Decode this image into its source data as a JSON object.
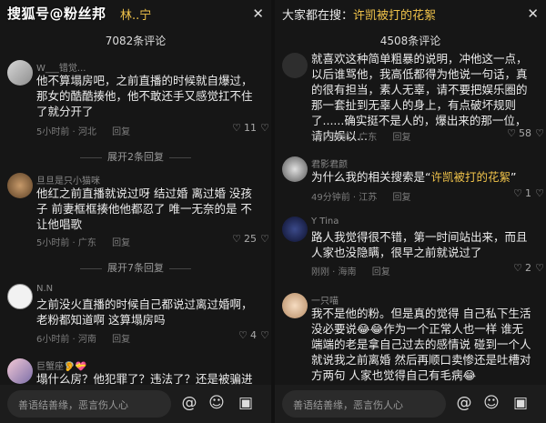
{
  "watermark": "搜狐号@粉丝邦",
  "left": {
    "header_query": "林..宁",
    "close_icon": "✕",
    "comment_count": "7082条评论",
    "comments": [
      {
        "user": "W___错觉...",
        "text": "他不算塌房吧，之前直播的时候就自爆过，那女的酷酷揍他，他不敢还手又感觉扛不住了就分开了",
        "time": "5小时前 · 河北",
        "reply": "回复",
        "likes": "11"
      },
      {
        "expand": "展开2条回复"
      },
      {
        "user": "旦旦是只小猫咪",
        "text": "他红之前直播就说过呀 结过婚 离过婚 没孩子 前妻框框揍他他都忍了 唯一无奈的是 不让他唱歌",
        "time": "5小时前 · 广东",
        "reply": "回复",
        "likes": "25"
      },
      {
        "expand": "展开7条回复"
      },
      {
        "user": "N.N",
        "text": "之前没火直播的时候自己都说过离过婚啊，老粉都知道啊 这算塌房吗",
        "time": "6小时前 · 河南",
        "reply": "回复",
        "likes": "4"
      },
      {
        "user": "巨蟹座🦻💝",
        "text": "塌什么房？他犯罪了？违法了？还是被骗进",
        "time": "",
        "reply": "",
        "likes": ""
      }
    ],
    "input_placeholder": "善语结善缘，恶言伤人心"
  },
  "right": {
    "header_prefix": "大家都在搜：",
    "header_query": "许凯被打的花絮",
    "close_icon": "✕",
    "comment_count": "4508条评论",
    "comments": [
      {
        "user": "",
        "text": "就喜欢这种简单粗暴的说明，冲他这一点，以后谁骂他，我高低都得为他说一句话，真的很有担当，素人无辜，请不要把娱乐圈的那一套扯到无辜人的身上，有点破坏规则了......确实挺不是人的，爆出来的那一位，请内娱以...",
        "time": "12分钟前 · 广东",
        "reply": "回复",
        "likes": "58"
      },
      {
        "user": "君影君颜",
        "text_prefix": "为什么我的相关搜索是“",
        "text_highlight": "许凯被打的花絮",
        "text_suffix": "”",
        "time": "49分钟前 · 江苏",
        "reply": "回复",
        "likes": "1"
      },
      {
        "user": "Y Tina",
        "text": "路人我觉得很不错，第一时间站出来，而且人家也没隐瞒，很早之前就说过了",
        "time": "刚刚 · 海南",
        "reply": "回复",
        "likes": "2"
      },
      {
        "user": "一只喵",
        "text": "我不是他的粉。但是真的觉得 自己私下生活没必要说😂😂作为一个正常人也一样 谁无端端的老是拿自己过去的感情说 碰到一个人就说我之前离婚 然后再顺口卖惨还是吐槽对方两句 人家也觉得自己有毛病😂",
        "time": "",
        "reply": "",
        "likes": ""
      }
    ],
    "input_placeholder": "善语结善缘，恶言伤人心"
  },
  "icons": {
    "at": "@",
    "emoji": "☺",
    "image": "▣",
    "heart": "♡",
    "dislike": "♡"
  }
}
